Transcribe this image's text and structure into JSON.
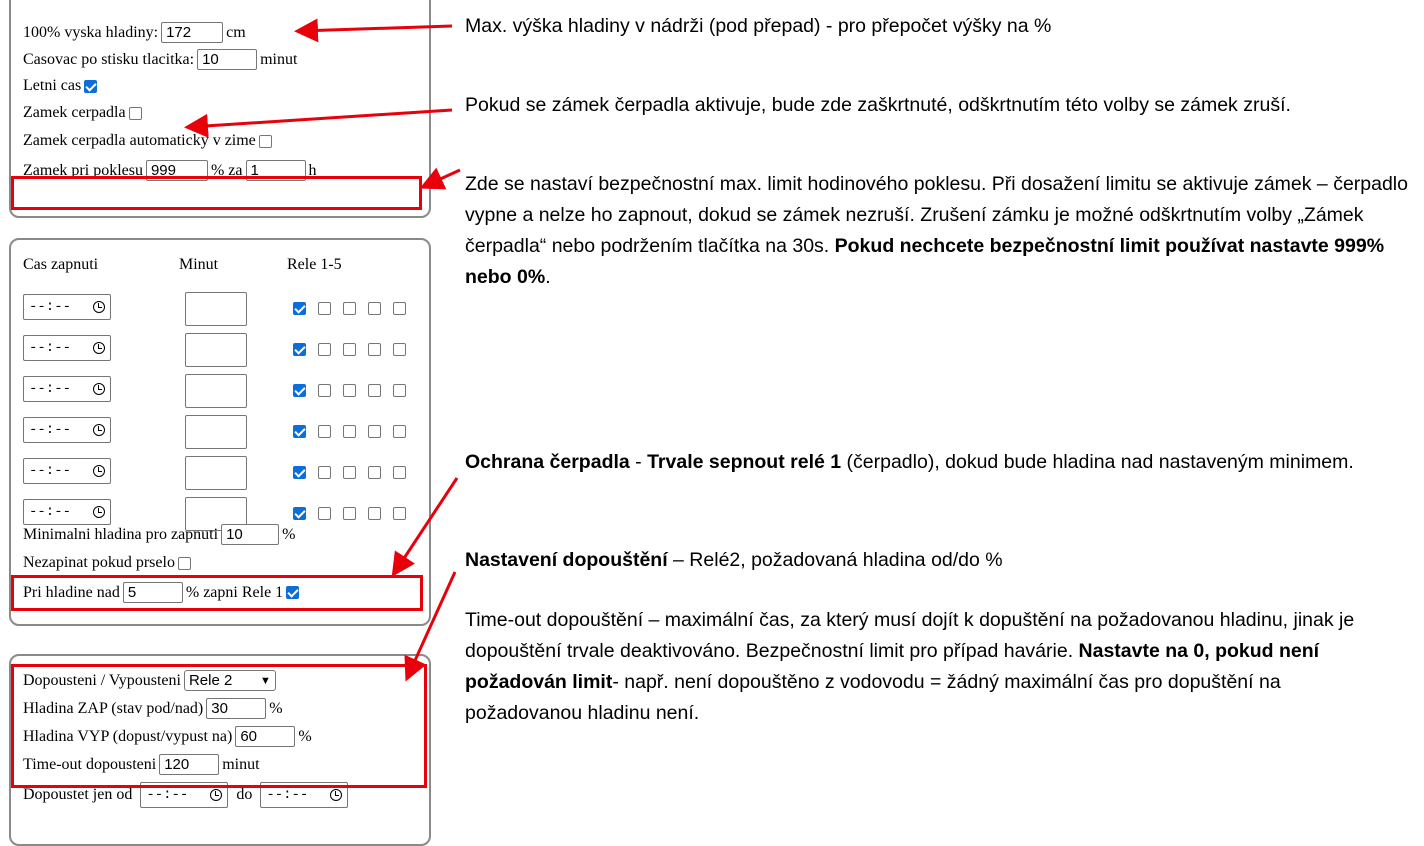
{
  "panel1": {
    "max_label": "100% vyska hladiny:",
    "max_value": "172",
    "max_unit": "cm",
    "timer_label": "Casovac po stisku tlacitka:",
    "timer_value": "10",
    "timer_unit": "minut",
    "summer_label": "Letni cas",
    "lock_label": "Zamek cerpadla",
    "lock_auto_label": "Zamek cerpadla automaticky v zime",
    "drop_label": "Zamek pri poklesu",
    "drop_value": "999",
    "drop_mid": "% za",
    "drop_hours": "1",
    "drop_unit": "h"
  },
  "panel2": {
    "col_time": "Cas zapnuti",
    "col_min": "Minut",
    "col_rele": "Rele 1-5",
    "time_placeholder": "--:--",
    "rows": 6,
    "min_level_label": "Minimalni hladina pro zapnuti",
    "min_level_value": "10",
    "min_level_unit": "%",
    "no_rain_label": "Nezapinat pokud prselo",
    "above_label": "Pri hladine nad",
    "above_value": "5",
    "above_suffix": "% zapni Rele 1"
  },
  "panel3": {
    "fill_label": "Dopousteni / Vypousteni",
    "fill_select": "Rele 2",
    "on_label": "Hladina ZAP (stav pod/nad)",
    "on_value": "30",
    "on_unit": "%",
    "off_label": "Hladina VYP (dopust/vypust na)",
    "off_value": "60",
    "off_unit": "%",
    "timeout_label": "Time-out dopousteni",
    "timeout_value": "120",
    "timeout_unit": "minut",
    "only_from_label": "Dopoustet jen od",
    "only_to_label": "do",
    "time_placeholder": "--:--"
  },
  "notes": {
    "n1": "Max. výška hladiny v nádrži (pod přepad) - pro přepočet výšky na %",
    "n2": "Pokud se zámek čerpadla aktivuje, bude zde zaškrtnuté, odškrtnutím této volby se zámek zruší.",
    "n3_plain": "Zde se nastaví bezpečnostní max. limit hodinového poklesu. Při dosažení limitu se aktivuje zámek – čerpadlo vypne a nelze ho zapnout, dokud se zámek nezruší. Zrušení zámku je možné odškrtnutím volby „Zámek čerpadla“ nebo podržením tlačítka na 30s. ",
    "n3_bold": "Pokud nechcete bezpečnostní limit používat nastavte 999% nebo 0%",
    "n3_end": ".",
    "n4_bold1": "Ochrana čerpadla",
    "n4_mid": " - ",
    "n4_bold2": "Trvale sepnout relé 1",
    "n4_rest": " (čerpadlo), dokud bude hladina nad nastaveným minimem.",
    "n5_bold": "Nastavení dopouštění",
    "n5_rest": " – Relé2, požadovaná hladina od/do %",
    "n6_plain": "Time-out dopouštění – maximální čas, za který musí dojít k dopuštění na požadovanou hladinu, jinak je dopouštění trvale deaktivováno. Bezpečnostní limit pro případ havárie. ",
    "n6_bold": "Nastavte na 0, pokud není požadován limit",
    "n6_rest": "- např. není dopouštěno z vodovodu = žádný maximální čas pro dopuštění na požadovanou hladinu není."
  },
  "colors": {
    "accent": "#e8000b",
    "check": "#0a6fd8",
    "border": "#8a8a8a"
  }
}
